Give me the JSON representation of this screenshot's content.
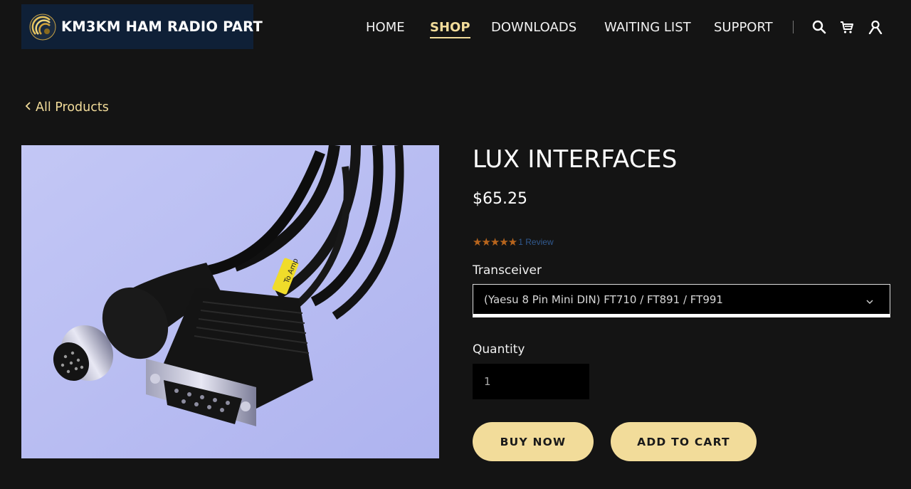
{
  "brand": {
    "name": "KM3KM HAM RADIO PART",
    "logo_icon": "radio-wave-logo-icon"
  },
  "nav": {
    "items": [
      {
        "label": "HOME",
        "active": false
      },
      {
        "label": "SHOP",
        "active": true
      },
      {
        "label": "DOWNLOADS",
        "active": false
      },
      {
        "label": "WAITING LIST",
        "active": false
      },
      {
        "label": "SUPPORT",
        "active": false
      }
    ],
    "icons": [
      "search-icon",
      "cart-icon",
      "account-icon"
    ]
  },
  "back_link": {
    "label": "All Products",
    "icon": "chevron-left-icon"
  },
  "product": {
    "title": "LUX INTERFACES",
    "price": "$65.25",
    "rating": {
      "stars": 5,
      "max": 5,
      "review_text": "1 Review"
    },
    "transceiver": {
      "label": "Transceiver",
      "selected": "(Yaesu 8 Pin Mini DIN) FT710 / FT891 / FT991"
    },
    "quantity": {
      "label": "Quantity",
      "value": "1"
    },
    "cable_tag": "To Amp"
  },
  "buttons": {
    "buy_now": "BUY NOW",
    "add_to_cart": "ADD TO CART"
  },
  "colors": {
    "background": "#141414",
    "accent": "#f2dc9a",
    "star": "#b8651d",
    "review_link": "#31598f",
    "logo_bg": "#0f2037"
  }
}
